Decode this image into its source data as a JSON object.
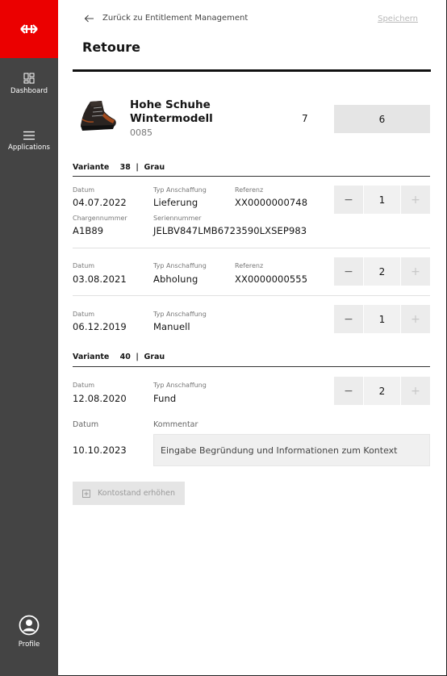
{
  "sidebar": {
    "items": [
      {
        "label": "Dashboard",
        "icon": "dashboard-icon"
      },
      {
        "label": "Applications",
        "icon": "menu-icon"
      }
    ],
    "profile_label": "Profile",
    "brand_color": "#eb0000",
    "background": "#444444"
  },
  "header": {
    "back_label": "Zurück zu Entitlement Management",
    "save_label": "Speichern",
    "title": "Retoure"
  },
  "product": {
    "name": "Hohe Schuhe Wintermodell",
    "code": "0085",
    "stock": "7",
    "return_total": "6"
  },
  "labels": {
    "datum": "Datum",
    "typ": "Typ Anschaffung",
    "referenz": "Referenz",
    "charge": "Chargennummer",
    "serie": "Seriennummer",
    "kommentar": "Kommentar"
  },
  "variants": [
    {
      "label": "Variante",
      "size": "38",
      "color": "Grau",
      "entries": [
        {
          "datum": "04.07.2022",
          "typ": "Lieferung",
          "referenz": "XX0000000748",
          "charge": "A1B89",
          "serie": "JELBV847LMB6723590LXSEP983",
          "count": "1"
        },
        {
          "datum": "03.08.2021",
          "typ": "Abholung",
          "referenz": "XX0000000555",
          "count": "2"
        },
        {
          "datum": "06.12.2019",
          "typ": "Manuell",
          "count": "1"
        }
      ]
    },
    {
      "label": "Variante",
      "size": "40",
      "color": "Grau",
      "entries": [
        {
          "datum": "12.08.2020",
          "typ": "Fund",
          "count": "2"
        }
      ]
    }
  ],
  "comment": {
    "datum": "10.10.2023",
    "placeholder": "Eingabe Begründung und Informationen zum Kontext"
  },
  "add_button_label": "Kontostand erhöhen",
  "stepper": {
    "minus": "−",
    "plus": "+"
  }
}
